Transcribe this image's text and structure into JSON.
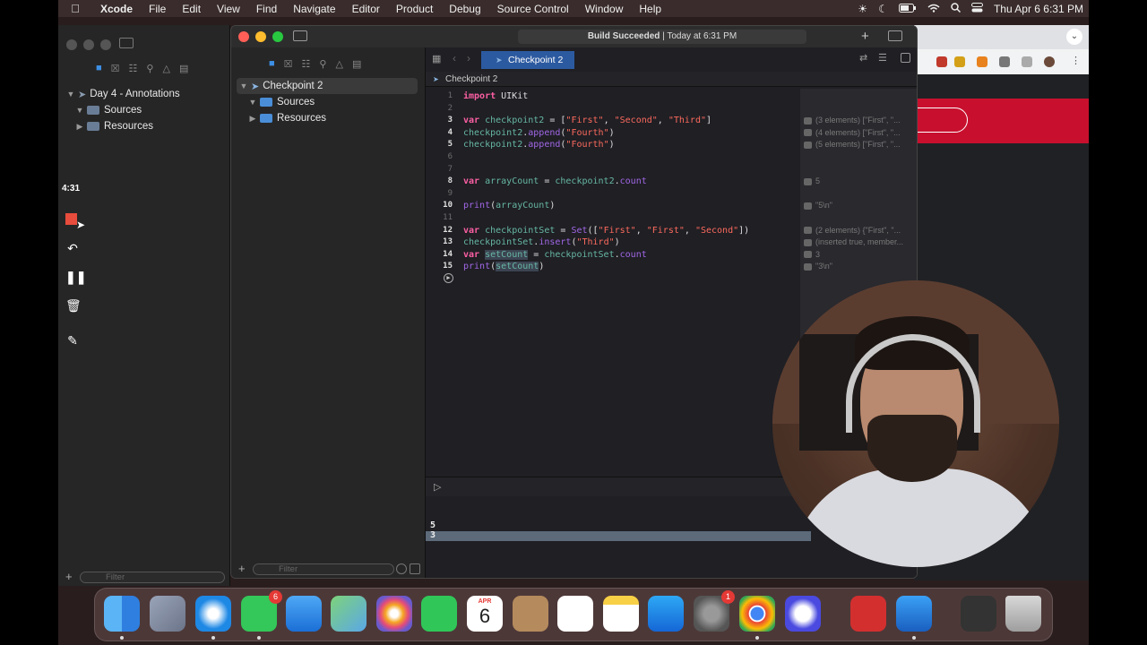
{
  "menubar": {
    "app": "Xcode",
    "items": [
      "File",
      "Edit",
      "View",
      "Find",
      "Navigate",
      "Editor",
      "Product",
      "Debug",
      "Source Control",
      "Window",
      "Help"
    ],
    "clock": "Thu Apr 6  6:31 PM"
  },
  "left_window": {
    "project": "Day 4 - Annotations",
    "items": [
      "Sources",
      "Resources"
    ],
    "filter_placeholder": "Filter"
  },
  "recorder": {
    "time": "4:31"
  },
  "main_window": {
    "status_bold": "Build Succeeded",
    "status_rest": " | Today at 6:31 PM",
    "tab_title": "Checkpoint 2",
    "jumpbar": "Checkpoint 2",
    "navigator": {
      "project": "Checkpoint 2",
      "items": [
        "Sources",
        "Resources"
      ],
      "filter_placeholder": "Filter"
    }
  },
  "code_lines": [
    {
      "n": "1",
      "bold": false,
      "parts": [
        {
          "t": "import",
          "c": "kw"
        },
        {
          "t": " UIKit",
          "c": ""
        }
      ]
    },
    {
      "n": "2",
      "bold": false,
      "parts": []
    },
    {
      "n": "3",
      "bold": true,
      "parts": [
        {
          "t": "var",
          "c": "kw"
        },
        {
          "t": " ",
          "c": ""
        },
        {
          "t": "checkpoint2",
          "c": "var"
        },
        {
          "t": " = [",
          "c": ""
        },
        {
          "t": "\"First\"",
          "c": "str"
        },
        {
          "t": ", ",
          "c": ""
        },
        {
          "t": "\"Second\"",
          "c": "str"
        },
        {
          "t": ", ",
          "c": ""
        },
        {
          "t": "\"Third\"",
          "c": "str"
        },
        {
          "t": "]",
          "c": ""
        }
      ]
    },
    {
      "n": "4",
      "bold": true,
      "parts": [
        {
          "t": "checkpoint2",
          "c": "var"
        },
        {
          "t": ".",
          "c": ""
        },
        {
          "t": "append",
          "c": "fn"
        },
        {
          "t": "(",
          "c": ""
        },
        {
          "t": "\"Fourth\"",
          "c": "str"
        },
        {
          "t": ")",
          "c": ""
        }
      ]
    },
    {
      "n": "5",
      "bold": true,
      "parts": [
        {
          "t": "checkpoint2",
          "c": "var"
        },
        {
          "t": ".",
          "c": ""
        },
        {
          "t": "append",
          "c": "fn"
        },
        {
          "t": "(",
          "c": ""
        },
        {
          "t": "\"Fourth\"",
          "c": "str"
        },
        {
          "t": ")",
          "c": ""
        }
      ]
    },
    {
      "n": "6",
      "bold": false,
      "parts": []
    },
    {
      "n": "7",
      "bold": false,
      "parts": []
    },
    {
      "n": "8",
      "bold": true,
      "parts": [
        {
          "t": "var",
          "c": "kw"
        },
        {
          "t": " ",
          "c": ""
        },
        {
          "t": "arrayCount",
          "c": "var"
        },
        {
          "t": " = ",
          "c": ""
        },
        {
          "t": "checkpoint2",
          "c": "var"
        },
        {
          "t": ".",
          "c": ""
        },
        {
          "t": "count",
          "c": "fn"
        }
      ]
    },
    {
      "n": "9",
      "bold": false,
      "parts": []
    },
    {
      "n": "10",
      "bold": true,
      "parts": [
        {
          "t": "print",
          "c": "fn"
        },
        {
          "t": "(",
          "c": ""
        },
        {
          "t": "arrayCount",
          "c": "var"
        },
        {
          "t": ")",
          "c": ""
        }
      ]
    },
    {
      "n": "11",
      "bold": false,
      "parts": []
    },
    {
      "n": "12",
      "bold": true,
      "parts": [
        {
          "t": "var",
          "c": "kw"
        },
        {
          "t": " ",
          "c": ""
        },
        {
          "t": "checkpointSet",
          "c": "var"
        },
        {
          "t": " = ",
          "c": ""
        },
        {
          "t": "Set",
          "c": "fn"
        },
        {
          "t": "([",
          "c": ""
        },
        {
          "t": "\"First\"",
          "c": "str"
        },
        {
          "t": ", ",
          "c": ""
        },
        {
          "t": "\"First\"",
          "c": "str"
        },
        {
          "t": ", ",
          "c": ""
        },
        {
          "t": "\"Second\"",
          "c": "str"
        },
        {
          "t": "])",
          "c": ""
        }
      ]
    },
    {
      "n": "13",
      "bold": true,
      "parts": [
        {
          "t": "checkpointSet",
          "c": "var"
        },
        {
          "t": ".",
          "c": ""
        },
        {
          "t": "insert",
          "c": "fn"
        },
        {
          "t": "(",
          "c": ""
        },
        {
          "t": "\"Third\"",
          "c": "str"
        },
        {
          "t": ")",
          "c": ""
        }
      ]
    },
    {
      "n": "14",
      "bold": true,
      "parts": [
        {
          "t": "var",
          "c": "kw"
        },
        {
          "t": " ",
          "c": ""
        },
        {
          "t": "setCount",
          "c": "var hl"
        },
        {
          "t": " = ",
          "c": ""
        },
        {
          "t": "checkpointSet",
          "c": "var"
        },
        {
          "t": ".",
          "c": ""
        },
        {
          "t": "count",
          "c": "fn"
        }
      ]
    },
    {
      "n": "15",
      "bold": true,
      "parts": [
        {
          "t": "print",
          "c": "fn"
        },
        {
          "t": "(",
          "c": ""
        },
        {
          "t": "setCount",
          "c": "var hl"
        },
        {
          "t": ")",
          "c": ""
        }
      ]
    }
  ],
  "results": [
    {
      "line": 3,
      "text": "(3 elements) [\"First\", \"..."
    },
    {
      "line": 4,
      "text": "(4 elements) [\"First\", \"..."
    },
    {
      "line": 5,
      "text": "(5 elements) [\"First\", \"..."
    },
    {
      "line": 8,
      "text": "5"
    },
    {
      "line": 10,
      "text": "\"5\\n\""
    },
    {
      "line": 12,
      "text": "(2 elements) {\"First\", \"..."
    },
    {
      "line": 13,
      "text": "(inserted true, member..."
    },
    {
      "line": 14,
      "text": "3"
    },
    {
      "line": 15,
      "text": "\"3\\n\""
    }
  ],
  "console_output": [
    "5",
    "3"
  ],
  "dock": {
    "messages_badge": "6",
    "settings_badge": "1",
    "calendar_month": "APR",
    "calendar_day": "6"
  }
}
